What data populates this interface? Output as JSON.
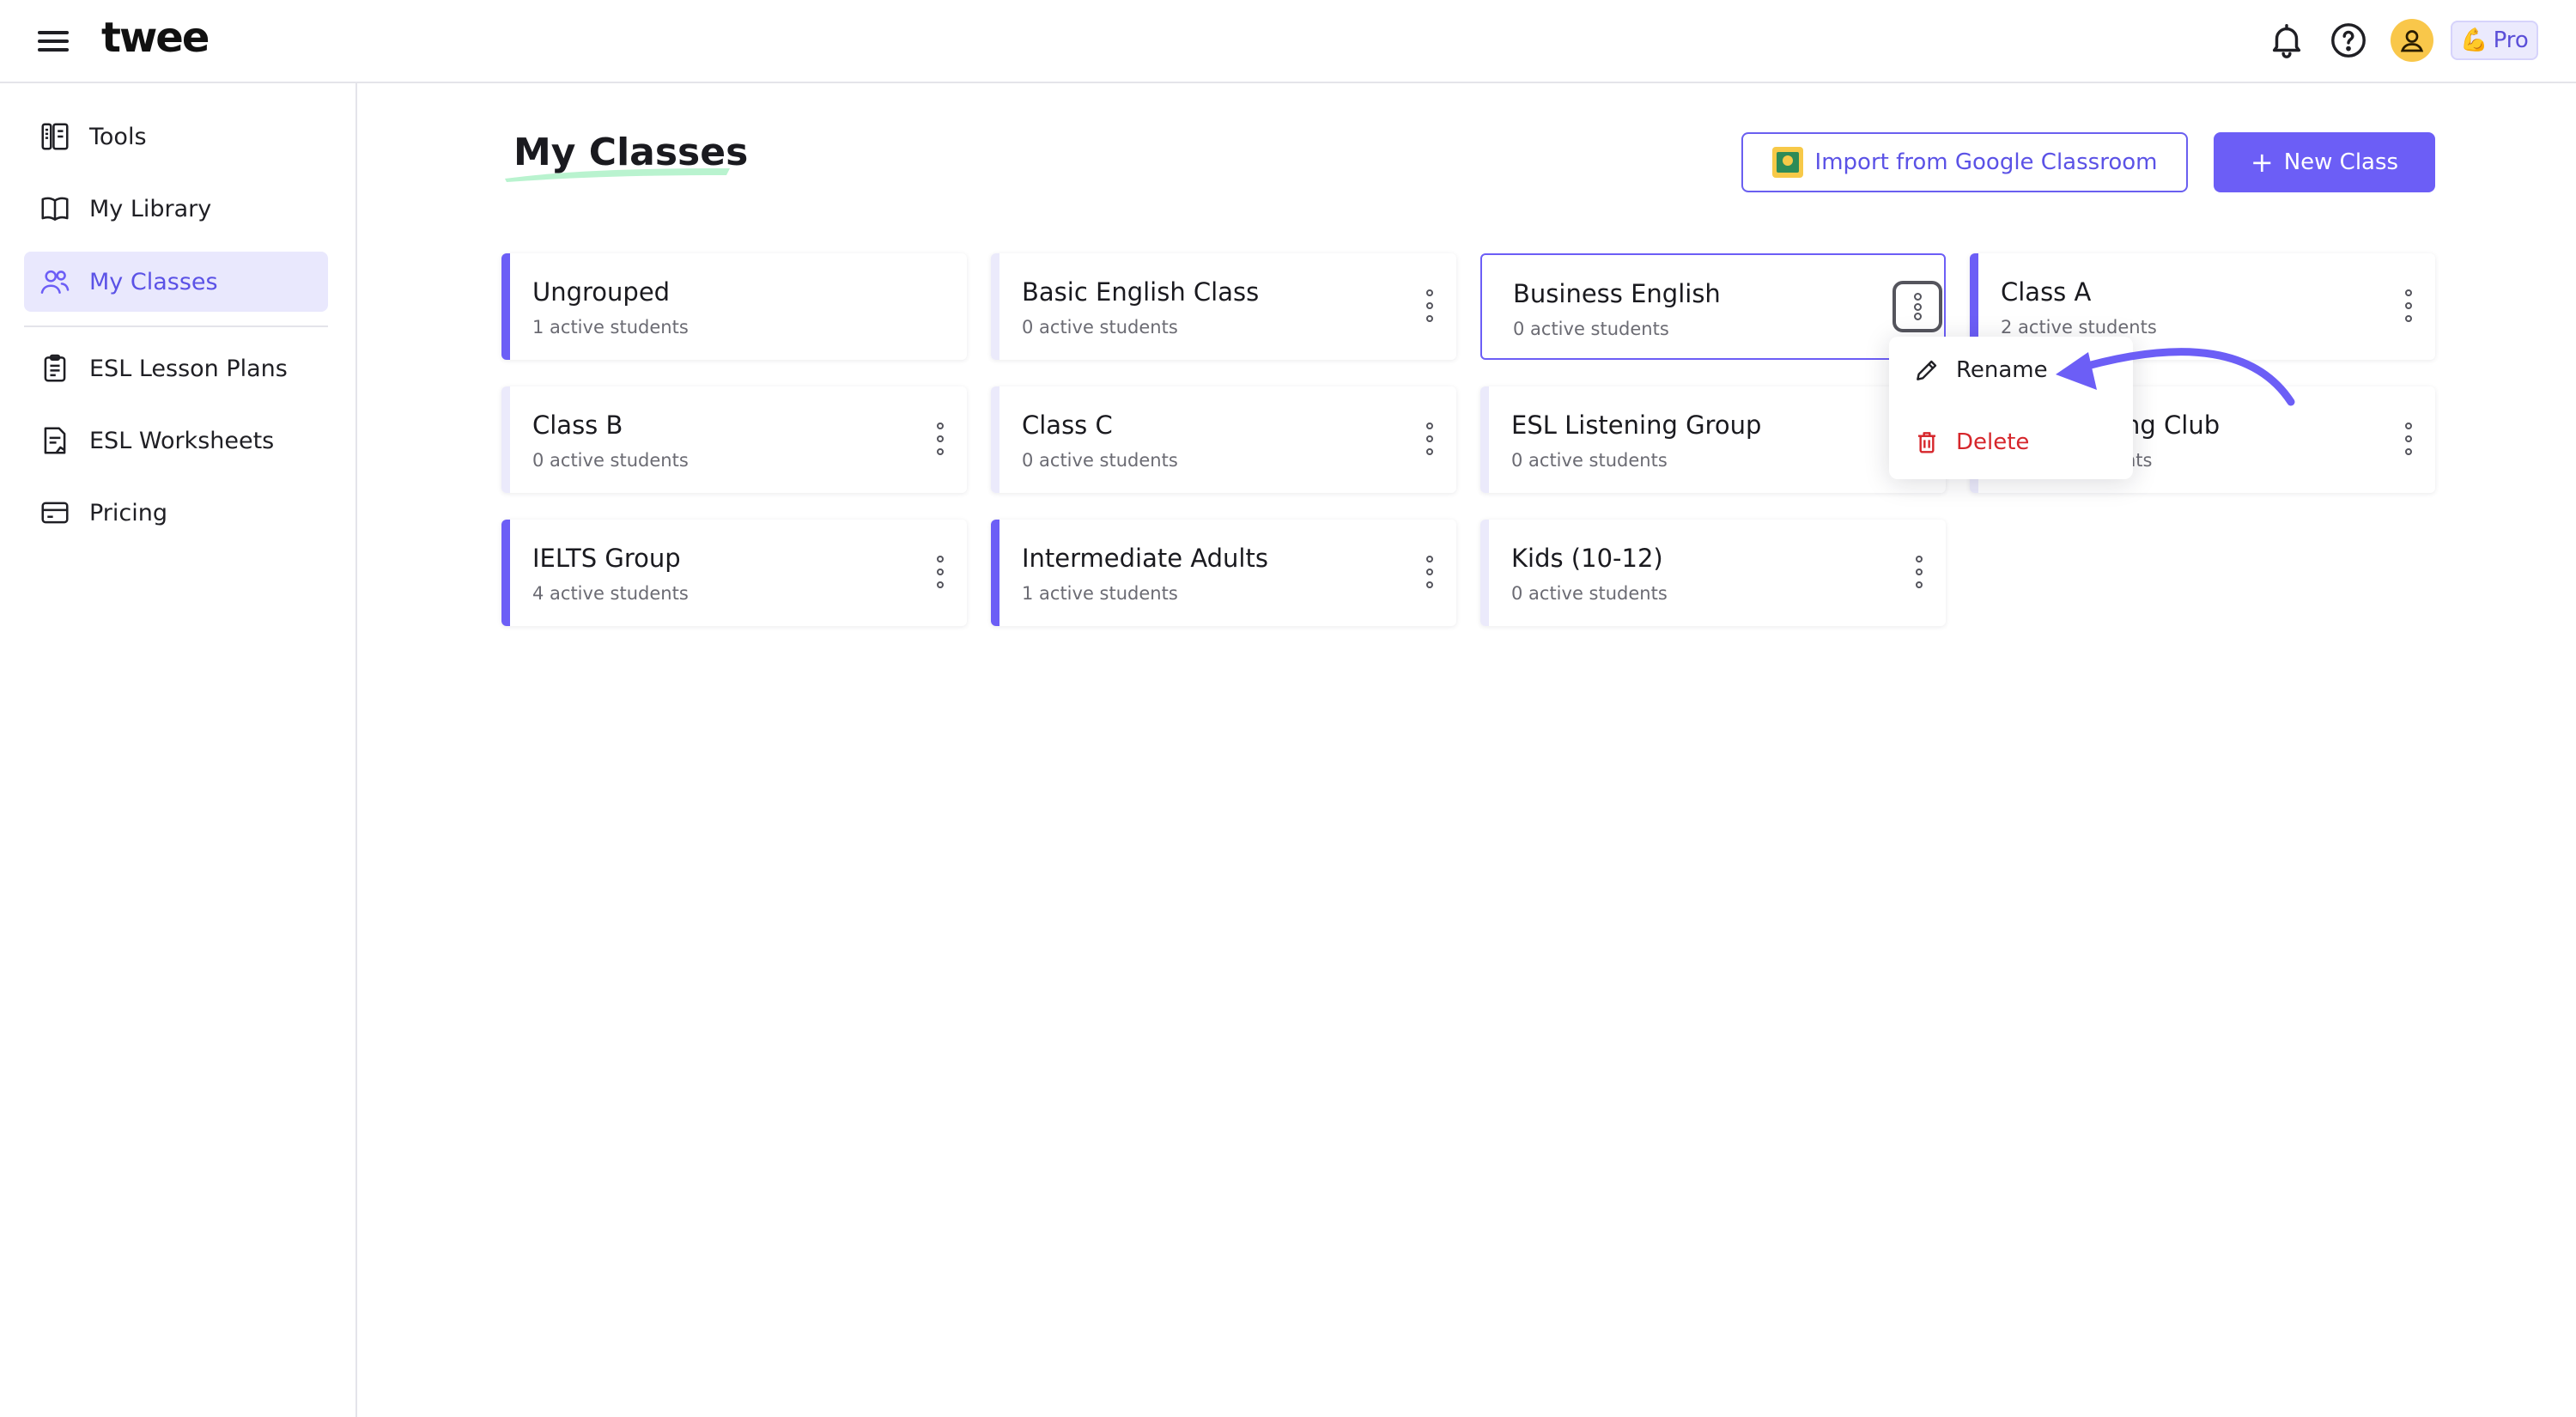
{
  "header": {
    "logo": "twee",
    "pro_label": "Pro",
    "pro_icon": "flexed-bicep"
  },
  "sidebar": {
    "items": [
      {
        "label": "Tools",
        "icon": "tools-icon"
      },
      {
        "label": "My Library",
        "icon": "book-icon"
      },
      {
        "label": "My Classes",
        "icon": "users-icon",
        "active": true
      },
      {
        "label": "ESL Lesson Plans",
        "icon": "clipboard-icon"
      },
      {
        "label": "ESL Worksheets",
        "icon": "worksheet-icon"
      },
      {
        "label": "Pricing",
        "icon": "card-icon"
      }
    ]
  },
  "main": {
    "title": "My Classes",
    "import_label": "Import from Google Classroom",
    "new_class_label": "New Class",
    "classes": [
      {
        "name": "Ungrouped",
        "students": "1 active students"
      },
      {
        "name": "Basic English Class",
        "students": "0 active students"
      },
      {
        "name": "Business English",
        "students": "0 active students"
      },
      {
        "name": "Class A",
        "students": "2 active students"
      },
      {
        "name": "Class B",
        "students": "0 active students"
      },
      {
        "name": "Class C",
        "students": "0 active students"
      },
      {
        "name": "ESL Listening Group",
        "students": "0 active students"
      },
      {
        "name": "ng Club",
        "students": "nts"
      },
      {
        "name": "IELTS Group",
        "students": "4 active students"
      },
      {
        "name": "Intermediate Adults",
        "students": "1 active students"
      },
      {
        "name": "Kids (10-12)",
        "students": "0 active students"
      }
    ]
  },
  "menu": {
    "rename": "Rename",
    "delete": "Delete"
  },
  "colors": {
    "accent": "#6c5ef6",
    "accent_light": "#e9e8fd",
    "danger": "#d6262b",
    "avatar": "#f9c74a"
  }
}
